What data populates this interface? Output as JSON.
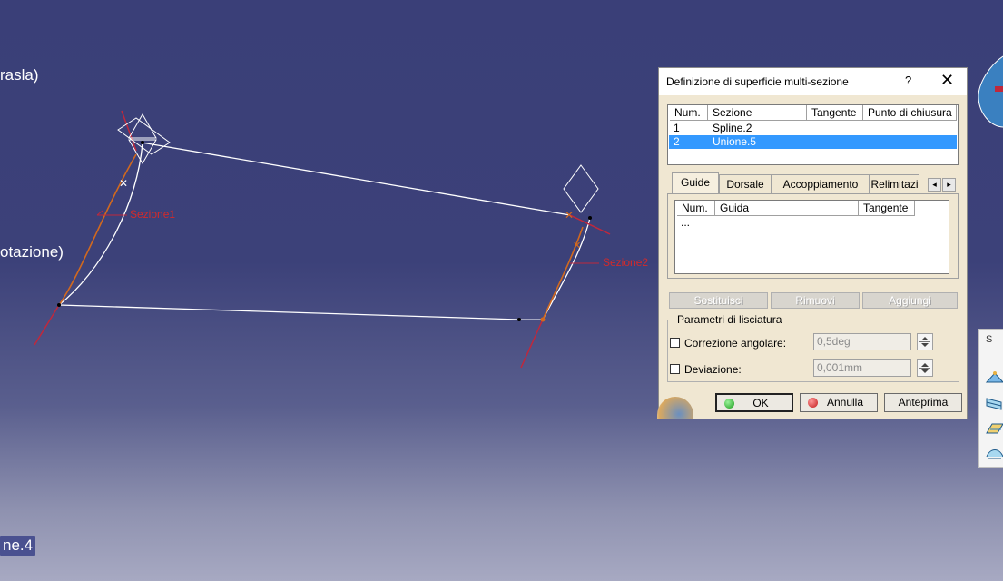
{
  "tree_labels": {
    "trasla": "rasla)",
    "rotazione": "otazione)",
    "item4": "ne.4"
  },
  "viewport_labels": {
    "sezione1": "Sezione1",
    "sezione2": "Sezione2"
  },
  "colors": {
    "background_top": "#3a3f78",
    "background_bottom": "#a7a9c2",
    "curve": "#ffffff",
    "section_label": "#d42a2a",
    "orange_curve": "#d2691e",
    "selection": "#3399ff",
    "dialog_bg": "#f0e7d2"
  },
  "dialog": {
    "title": "Definizione di superficie multi-sezione",
    "help_label": "?",
    "close_label": "✕",
    "sections_table": {
      "headers": [
        "Num.",
        "Sezione",
        "Tangente",
        "Punto di chiusura"
      ],
      "rows": [
        {
          "num": "1",
          "sezione": "Spline.2",
          "tangente": "",
          "punto": ""
        },
        {
          "num": "2",
          "sezione": "Unione.5",
          "tangente": "",
          "punto": ""
        }
      ],
      "selected_row": 2
    },
    "tabs": [
      "Guide",
      "Dorsale",
      "Accoppiamento",
      "Relimitazi"
    ],
    "active_tab": "Guide",
    "guide_table": {
      "headers": [
        "Num.",
        "Guida",
        "Tangente"
      ],
      "rows": [
        {
          "num": "...",
          "guida": "",
          "tangente": ""
        }
      ]
    },
    "actions": {
      "sostituisci": "Sostituisci",
      "rimuovi": "Rimuovi",
      "aggiungi": "Aggiungi"
    },
    "smoothing": {
      "group_label": "Parametri di lisciatura",
      "angular_label": "Correzione angolare:",
      "angular_value": "0,5deg",
      "angular_checked": false,
      "deviation_label": "Deviazione:",
      "deviation_value": "0,001mm",
      "deviation_checked": false
    },
    "buttons": {
      "ok": "OK",
      "annulla": "Annulla",
      "anteprima": "Anteprima"
    }
  },
  "side_panel": {
    "title": "S",
    "tools": [
      "multi-section-surface-icon",
      "loft-icon",
      "sweep-icon",
      "blend-icon"
    ]
  }
}
